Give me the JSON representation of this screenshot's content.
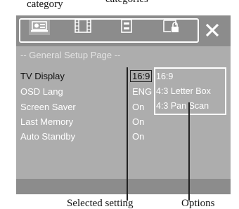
{
  "callouts": {
    "top_left": "category",
    "top_right": "categories",
    "bottom_left": "Selected setting",
    "bottom_right": "Options"
  },
  "toolbar": {
    "tabs": [
      {
        "icon": "general-setup-icon",
        "active": true
      },
      {
        "icon": "film-icon",
        "active": false
      },
      {
        "icon": "preference-icon",
        "active": false
      },
      {
        "icon": "password-lock-icon",
        "active": false
      }
    ],
    "close_icon": "close-icon"
  },
  "page": {
    "title": "-- General Setup Page --",
    "rows": [
      {
        "label": "TV Display",
        "value": "16:9",
        "selected": true
      },
      {
        "label": "OSD Lang",
        "value": "ENG",
        "selected": false
      },
      {
        "label": "Screen Saver",
        "value": "On",
        "selected": false
      },
      {
        "label": "Last Memory",
        "value": "On",
        "selected": false
      },
      {
        "label": "Auto Standby",
        "value": "On",
        "selected": false
      }
    ],
    "options": [
      "16:9",
      "4:3 Letter Box",
      "4:3 Pan Scan"
    ],
    "highlighted_option": "16:9"
  },
  "colors": {
    "toolbar_bg": "#8c8c8c",
    "content_bg": "#adadad",
    "active_tab_bg": "#a8a8a8",
    "text_white": "#ffffff",
    "text_dark": "#111111"
  }
}
